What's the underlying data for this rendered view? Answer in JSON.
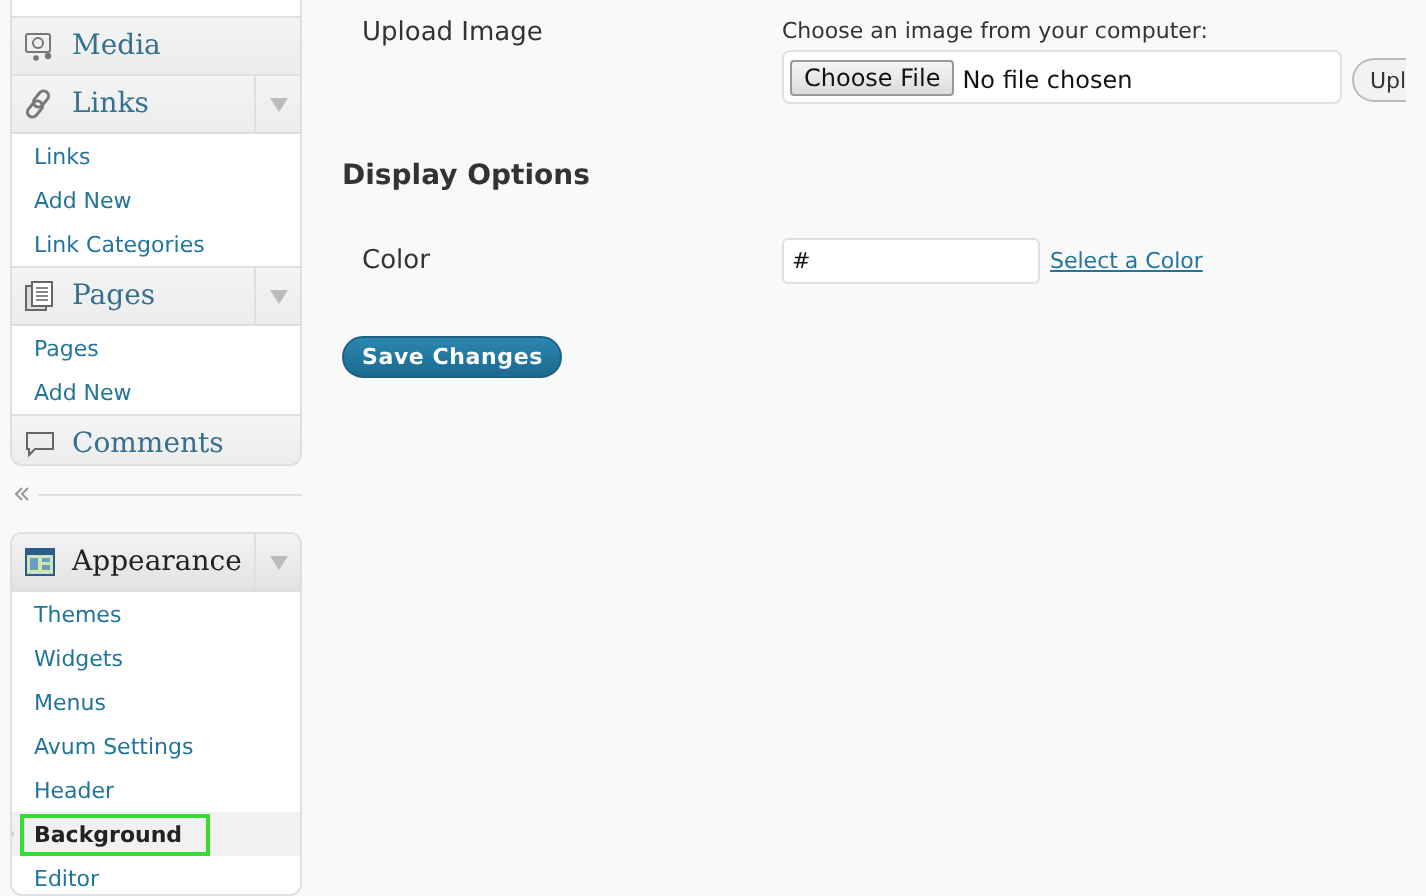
{
  "sidebar": {
    "groups": [
      {
        "menus": [
          {
            "label": "Media",
            "kind": "media",
            "current": false
          },
          {
            "label": "Links",
            "kind": "links",
            "current": false,
            "items": [
              {
                "label": "Links",
                "selected": false
              },
              {
                "label": "Add New",
                "selected": false
              },
              {
                "label": "Link Categories",
                "selected": false
              }
            ]
          },
          {
            "label": "Pages",
            "kind": "pages",
            "current": false,
            "items": [
              {
                "label": "Pages",
                "selected": false
              },
              {
                "label": "Add New",
                "selected": false
              }
            ]
          },
          {
            "label": "Comments",
            "kind": "comments",
            "current": false
          }
        ]
      },
      {
        "menus": [
          {
            "label": "Appearance",
            "kind": "appearance",
            "current": true,
            "items": [
              {
                "label": "Themes",
                "selected": false
              },
              {
                "label": "Widgets",
                "selected": false
              },
              {
                "label": "Menus",
                "selected": false
              },
              {
                "label": "Avum Settings",
                "selected": false
              },
              {
                "label": "Header",
                "selected": false
              },
              {
                "label": "Background",
                "selected": true
              },
              {
                "label": "Editor",
                "selected": false
              }
            ]
          }
        ]
      }
    ]
  },
  "upload": {
    "label": "Upload Image",
    "hint": "Choose an image from your computer:",
    "choose_button": "Choose File",
    "file_status": "No file chosen",
    "upload_button": "Upl"
  },
  "display_options": {
    "heading": "Display Options",
    "color_label": "Color",
    "color_value": "#",
    "color_link": "Select a Color"
  },
  "save_button": "Save Changes"
}
